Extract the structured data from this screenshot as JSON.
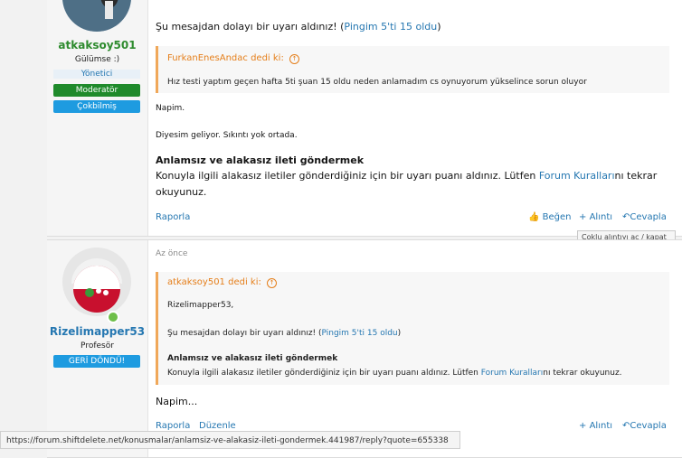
{
  "colors": {
    "accent": "#2577b1",
    "quote_border": "#f0a85a",
    "quote_author": "#e57f1b",
    "moderator": "#1f8a2b",
    "button_blue": "#1e9be0"
  },
  "post1": {
    "author": {
      "name": "atkaksoy501",
      "title": "Gülümse :)",
      "role": "Yönetici",
      "badge_moderator": "Moderatör",
      "badge_status": "Çokbilmiş"
    },
    "warning_text": "Şu mesajdan dolayı bir uyarı aldınız! (",
    "warning_link": "Pingim 5'ti 15 oldu",
    "warning_close": ")",
    "quote": {
      "author": "FurkanEnesAndac dedi ki:",
      "icon": "arrow-up-circle-icon",
      "text": "Hız testi yaptım geçen hafta 5ti şuan 15 oldu neden anlamadım cs oynuyorum yükselince sorun oluyor"
    },
    "reply_line1": "Napim.",
    "reply_line2": "Diyesim geliyor. Sıkıntı yok ortada.",
    "heading": "Anlamsız ve alakasız ileti göndermek",
    "body_part1": "Konuyla ilgili alakasız iletiler gönderdiğiniz için bir uyarı puanı aldınız. Lütfen ",
    "body_link": "Forum Kuralları",
    "body_part2": "nı tekrar",
    "body_line2": "okuyunuz.",
    "actions": {
      "report": "Raporla",
      "like": "Beğen",
      "quote": "Alıntı",
      "reply": "Cevapla"
    }
  },
  "tooltip": "Çoklu alıntıyı aç / kapat",
  "post2": {
    "time": "Az önce",
    "author": {
      "name": "Rizelimapper53",
      "title": "Profesör",
      "badge_status": "GERİ DÖNDÜ!"
    },
    "quote": {
      "author": "atkaksoy501 dedi ki:",
      "line1": "Rizelimapper53,",
      "warning_text": "Şu mesajdan dolayı bir uyarı aldınız! (",
      "warning_link": "Pingim 5'ti 15 oldu",
      "warning_close": ")",
      "heading": "Anlamsız ve alakasız ileti göndermek",
      "body_part1": "Konuyla ilgili alakasız iletiler gönderdiğiniz için bir uyarı puanı aldınız. Lütfen ",
      "body_link": "Forum Kuralları",
      "body_part2": "nı tekrar okuyunuz."
    },
    "text": "Napim...",
    "actions": {
      "report": "Raporla",
      "edit": "Düzenle",
      "quote": "Alıntı",
      "reply": "Cevapla"
    }
  },
  "status_url": "https://forum.shiftdelete.net/konusmalar/anlamsiz-ve-alakasiz-ileti-gondermek.441987/reply?quote=655338"
}
